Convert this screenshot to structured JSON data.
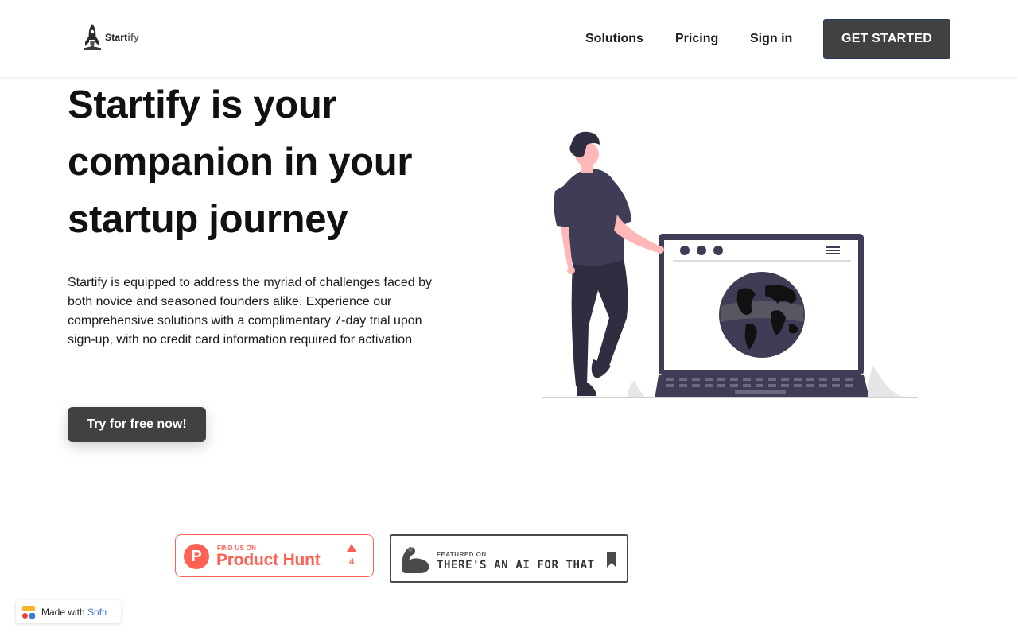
{
  "header": {
    "logo_text_main": "Start",
    "logo_text_dim": "ify",
    "nav": [
      "Solutions",
      "Pricing",
      "Sign in"
    ],
    "cta_label": "GET STARTED"
  },
  "hero": {
    "title": "Startify is your companion in your startup journey",
    "description": "Startify is equipped to address the myriad of challenges faced by both novice and seasoned founders alike. Experience our comprehensive solutions with a complimentary 7-day trial upon sign-up, with no credit card information required for activation",
    "button_label": "Try for free now!"
  },
  "badges": {
    "producthunt": {
      "letter": "P",
      "small": "FIND US ON",
      "big": "Product Hunt",
      "count": "4",
      "color": "#ff6154"
    },
    "aiforthat": {
      "small": "FEATURED ON",
      "big": "THERE'S AN AI FOR THAT"
    }
  },
  "softr": {
    "prefix": "Made with",
    "brand": "Softr"
  },
  "colors": {
    "dark_button": "#414141",
    "illustration_purple": "#3f3d56",
    "skin": "#ffb8b8"
  }
}
